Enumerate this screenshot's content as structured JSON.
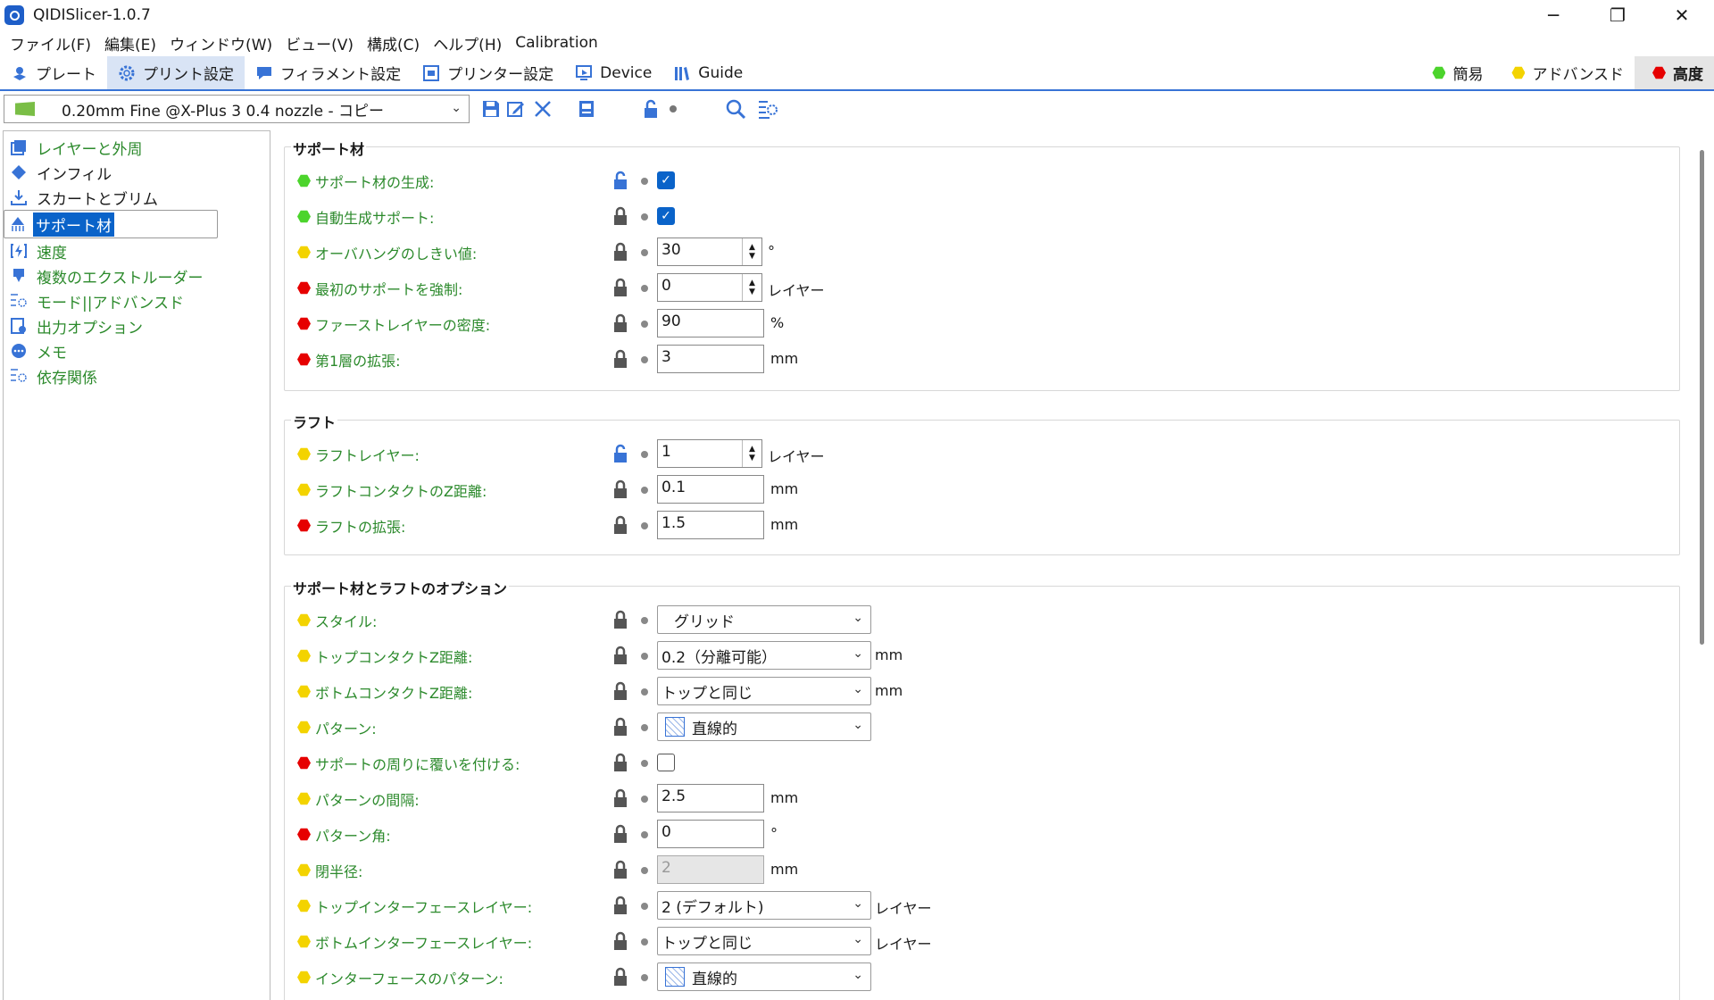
{
  "window": {
    "title": "QIDISlicer-1.0.7",
    "minimize": "─",
    "restore": "❐",
    "close": "✕"
  },
  "menu": [
    "ファイル(F)",
    "編集(E)",
    "ウィンドウ(W)",
    "ビュー(V)",
    "構成(C)",
    "ヘルプ(H)",
    "Calibration"
  ],
  "tabs": [
    {
      "label": "プレート",
      "icon": "plate-icon"
    },
    {
      "label": "プリント設定",
      "icon": "gear-icon",
      "active": true
    },
    {
      "label": "フィラメント設定",
      "icon": "filament-icon"
    },
    {
      "label": "プリンター設定",
      "icon": "printer-icon"
    },
    {
      "label": "Device",
      "icon": "device-icon"
    },
    {
      "label": "Guide",
      "icon": "guide-icon"
    }
  ],
  "modes": [
    {
      "label": "簡易",
      "color": "#4cd42c"
    },
    {
      "label": "アドバンスド",
      "color": "#f3d300"
    },
    {
      "label": "高度",
      "color": "#e60000",
      "active": true
    }
  ],
  "preset": {
    "name": "0.20mm Fine @X-Plus 3 0.4 nozzle - コピー"
  },
  "sidebar": [
    {
      "label": "レイヤーと外周",
      "icon": "layers-icon"
    },
    {
      "label": "インフィル",
      "icon": "infill-icon"
    },
    {
      "label": "スカートとブリム",
      "icon": "skirt-icon"
    },
    {
      "label": "サポート材",
      "icon": "support-icon",
      "selected": true
    },
    {
      "label": "速度",
      "icon": "speed-icon"
    },
    {
      "label": "複数のエクストルーダー",
      "icon": "extruder-icon"
    },
    {
      "label": "モード||アドバンスド",
      "icon": "advanced-icon"
    },
    {
      "label": "出力オプション",
      "icon": "output-icon"
    },
    {
      "label": "メモ",
      "icon": "notes-icon"
    },
    {
      "label": "依存関係",
      "icon": "dependencies-icon"
    }
  ],
  "sections": {
    "support": {
      "title": "サポート材"
    },
    "raft": {
      "title": "ラフト"
    },
    "options": {
      "title": "サポート材とラフトのオプション"
    }
  },
  "fields": {
    "generate": {
      "label": "サポート材の生成:",
      "checked": true
    },
    "auto": {
      "label": "自動生成サポート:",
      "checked": true
    },
    "overhang": {
      "label": "オーバハングのしきい値:",
      "value": "30",
      "unit": "°"
    },
    "enforce": {
      "label": "最初のサポートを強制:",
      "value": "0",
      "unit": "レイヤー"
    },
    "first_density": {
      "label": "ファーストレイヤーの密度:",
      "value": "90",
      "unit": "%"
    },
    "first_expand": {
      "label": "第1層の拡張:",
      "value": "3",
      "unit": "mm"
    },
    "raft_layers": {
      "label": "ラフトレイヤー:",
      "value": "1",
      "unit": "レイヤー"
    },
    "raft_z": {
      "label": "ラフトコンタクトのZ距離:",
      "value": "0.1",
      "unit": "mm"
    },
    "raft_expand": {
      "label": "ラフトの拡張:",
      "value": "1.5",
      "unit": "mm"
    },
    "style": {
      "label": "スタイル:",
      "value": "グリッド"
    },
    "top_z": {
      "label": "トップコンタクトZ距離:",
      "value": "0.2（分離可能）",
      "unit": "mm"
    },
    "bottom_z": {
      "label": "ボトムコンタクトZ距離:",
      "value": "トップと同じ",
      "unit": "mm"
    },
    "pattern": {
      "label": "パターン:",
      "value": "直線的"
    },
    "with_sheath": {
      "label": "サポートの周りに覆いを付ける:",
      "checked": false
    },
    "spacing": {
      "label": "パターンの間隔:",
      "value": "2.5",
      "unit": "mm"
    },
    "angle": {
      "label": "パターン角:",
      "value": "0",
      "unit": "°"
    },
    "closing_radius": {
      "label": "閉半径:",
      "value": "2",
      "unit": "mm"
    },
    "top_if": {
      "label": "トップインターフェースレイヤー:",
      "value": "2 (デフォルト)",
      "unit": "レイヤー"
    },
    "bottom_if": {
      "label": "ボトムインターフェースレイヤー:",
      "value": "トップと同じ",
      "unit": "レイヤー"
    },
    "if_pattern": {
      "label": "インターフェースのパターン:",
      "value": "直線的"
    }
  }
}
